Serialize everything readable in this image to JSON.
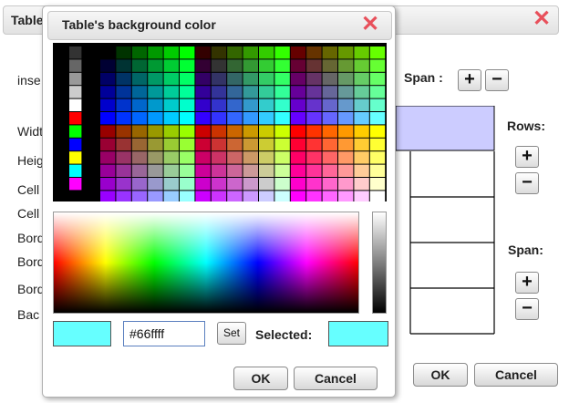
{
  "back_dialog": {
    "title": "Table",
    "span_label": "Span :",
    "rows_label": "Rows:",
    "span_label_2": "Span:",
    "insert_label": "inse",
    "field_labels": [
      "Widt",
      "Heig",
      "Cell",
      "Cell",
      "Bord",
      "Bord",
      "Bord",
      "Bac"
    ],
    "ok_label": "OK",
    "cancel_label": "Cancel",
    "close_glyph": "✕",
    "plus_glyph": "+",
    "minus_glyph": "−",
    "highlight_color": "#ccccff"
  },
  "color_dialog": {
    "title": "Table's background color",
    "close_glyph": "✕",
    "hex_value": "#66ffff",
    "set_label": "Set",
    "selected_label": "Selected:",
    "ok_label": "OK",
    "cancel_label": "Cancel",
    "current_color": "#66ffff",
    "selected_color": "#66ffff",
    "palette_side_colors": [
      "#333333",
      "#666666",
      "#999999",
      "#cccccc",
      "#ffffff",
      "#ff0000",
      "#00ff00",
      "#0000ff",
      "#ffff00",
      "#00ffff",
      "#ff00ff"
    ]
  }
}
